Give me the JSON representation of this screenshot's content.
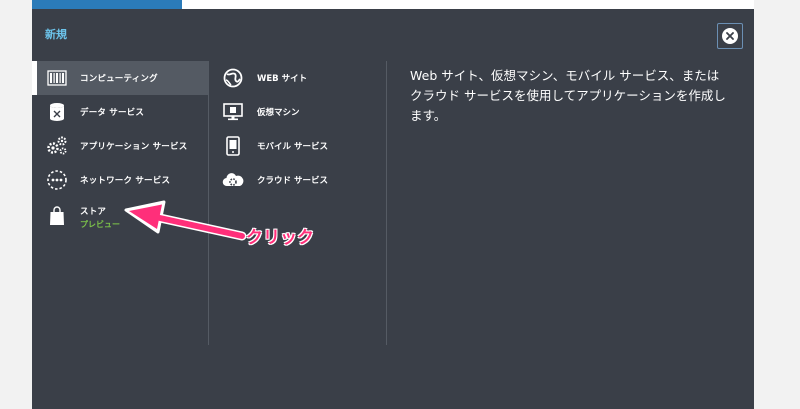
{
  "panel": {
    "title": "新規"
  },
  "categories": [
    {
      "label": "コンピューティング",
      "icon": "compute-icon",
      "selected": true
    },
    {
      "label": "データ サービス",
      "icon": "database-icon"
    },
    {
      "label": "アプリケーション サービス",
      "icon": "gears-icon"
    },
    {
      "label": "ネットワーク サービス",
      "icon": "network-icon"
    },
    {
      "label": "ストア",
      "sublabel": "プレビュー",
      "icon": "shopping-bag-icon"
    }
  ],
  "services": [
    {
      "label": "WEB サイト",
      "icon": "globe-icon"
    },
    {
      "label": "仮想マシン",
      "icon": "monitor-icon"
    },
    {
      "label": "モバイル サービス",
      "icon": "phone-icon"
    },
    {
      "label": "クラウド サービス",
      "icon": "cloud-gear-icon"
    }
  ],
  "description": "Web サイト、仮想マシン、モバイル サービス、またはクラウド サービスを使用してアプリケーションを作成します。",
  "annotation": {
    "text": "クリック",
    "color": "#ff2f7a"
  },
  "colors": {
    "panel": "#3a3f48",
    "selected": "#545a63",
    "title": "#6cc3ea",
    "preview": "#7cc34a"
  }
}
